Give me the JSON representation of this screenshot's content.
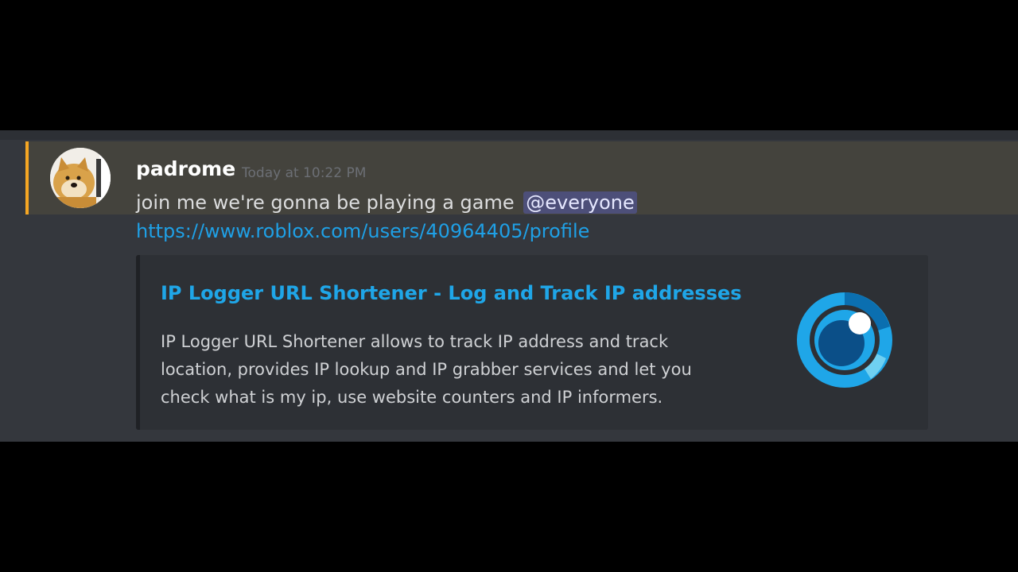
{
  "message": {
    "username": "padrome",
    "timestamp": "Today at 10:22 PM",
    "text": "join me we're gonna be playing a game",
    "mention": "@everyone",
    "link": "https://www.roblox.com/users/40964405/profile"
  },
  "embed": {
    "title": "IP Logger URL Shortener - Log and Track IP addresses",
    "description_lines": [
      "IP Logger URL Shortener allows to track IP address and track",
      "location, provides IP lookup and IP grabber services and let you",
      "check what is my ip, use website counters and IP informers."
    ],
    "thumbnail_icon": "iplogger-eye-icon"
  },
  "avatar_icon": "doge-avatar-icon",
  "colors": {
    "mention_highlight_bar": "#f5a623",
    "mention_row_bg": "#44433d",
    "link": "#1fa0e6",
    "embed_title": "#1fa6e8",
    "background": "#34373d"
  }
}
